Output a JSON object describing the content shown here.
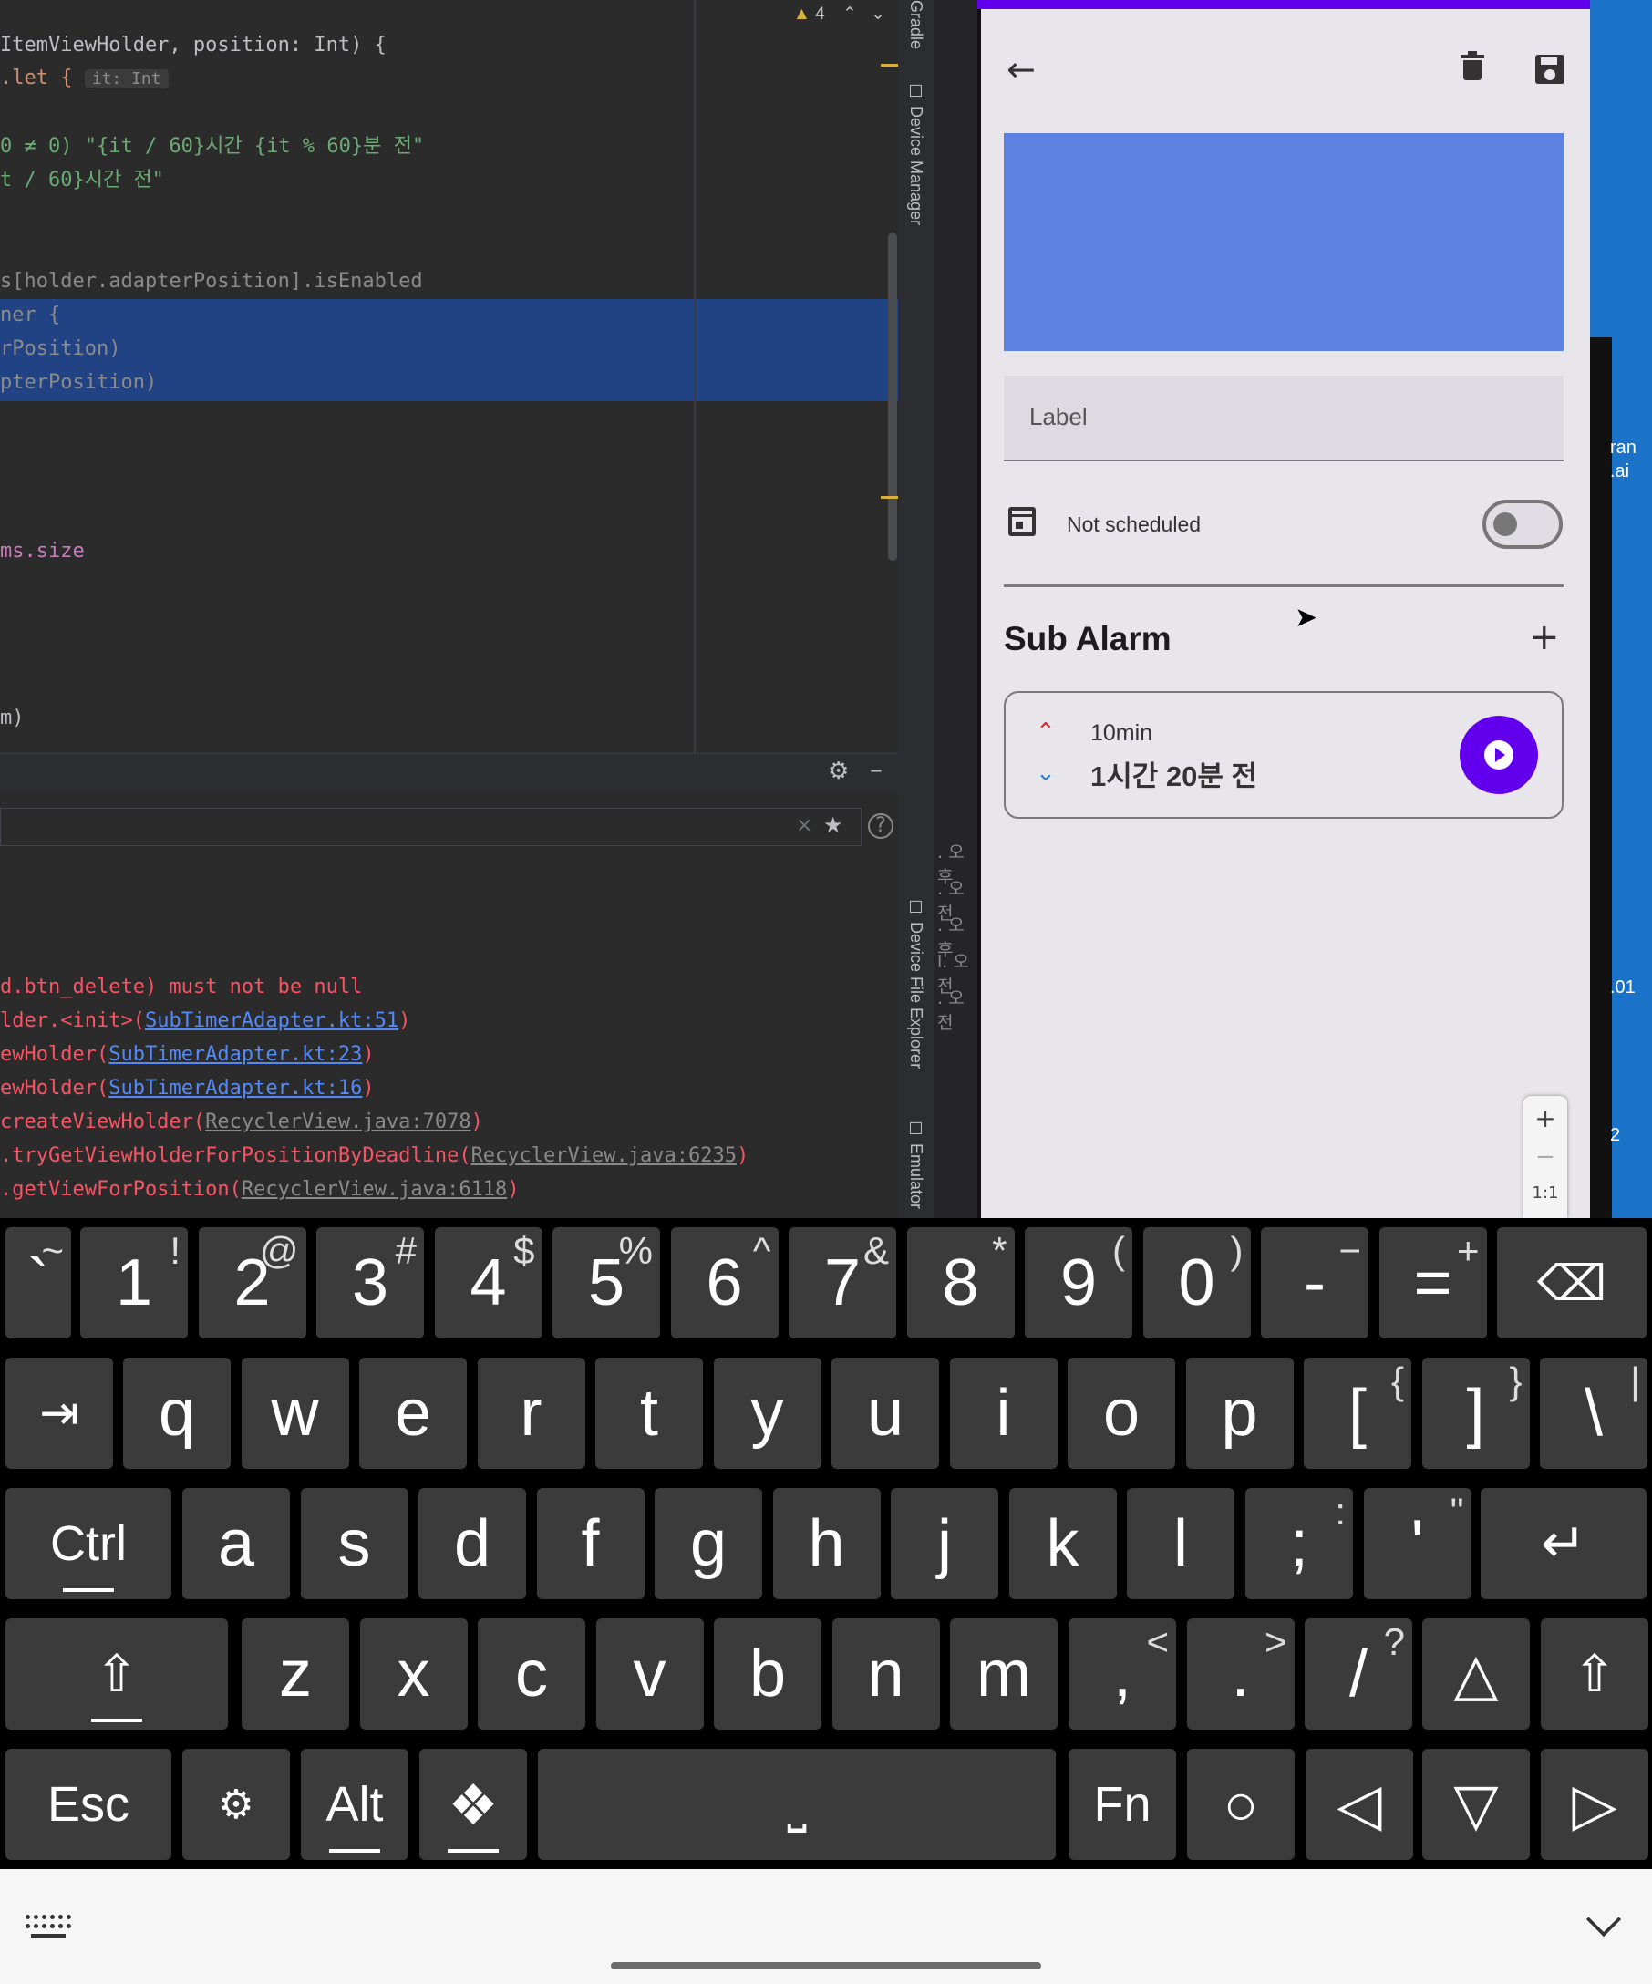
{
  "ide": {
    "warning_count": "4",
    "code_lines": [
      {
        "t": "ItemViewHolder, position: Int) {"
      },
      {
        "t": ".let {"
      },
      {
        "t": "0 ≠ 0) \"{it / 60}시간 {it % 60}분 전\""
      },
      {
        "t": "t / 60}시간 전\""
      },
      {
        "t": "s[holder.adapterPosition].isEnabled"
      },
      {
        "t": "ner {"
      },
      {
        "t": "rPosition)"
      },
      {
        "t": "pterPosition)"
      },
      {
        "t": "ms.size"
      },
      {
        "t": "m)"
      }
    ],
    "inlay_hint": "it: Int",
    "side_tabs": [
      "Gradle",
      "Device Manager",
      "Device File Explorer",
      "Emulator"
    ],
    "console_lines": [
      {
        "plain": "d.btn_delete) must not be null",
        "link": "",
        "tail": "",
        "style": "err"
      },
      {
        "plain": "lder.<init>(",
        "link": "SubTimerAdapter.kt:51",
        "tail": ")",
        "style": "err"
      },
      {
        "plain": "ewHolder(",
        "link": "SubTimerAdapter.kt:23",
        "tail": ")",
        "style": "err"
      },
      {
        "plain": "ewHolder(",
        "link": "SubTimerAdapter.kt:16",
        "tail": ")",
        "style": "err"
      },
      {
        "plain": "createViewHolder(",
        "link": "RecyclerView.java:7078",
        "tail": ")",
        "style": "errg"
      },
      {
        "plain": ".tryGetViewHolderForPositionByDeadline(",
        "link": "RecyclerView.java:6235",
        "tail": ")",
        "style": "errg"
      },
      {
        "plain": ".getViewForPosition(",
        "link": "RecyclerView.java:6118",
        "tail": ")",
        "style": "errg"
      }
    ],
    "log_fragments": [
      ". 오후",
      ". 오전",
      ". 오후",
      "l. 오전",
      ". 오전"
    ]
  },
  "phone": {
    "label_placeholder": "Label",
    "schedule_text": "Not scheduled",
    "sub_alarm_title": "Sub Alarm",
    "sub_item": {
      "duration": "10min",
      "time_before": "1시간 20분 전"
    },
    "zoom": {
      "plus": "+",
      "minus": "−",
      "ratio": "1:1"
    },
    "accent": "#6200ee",
    "color_block": "#5b82e3"
  },
  "right_edge_text": [
    "ran",
    ".ai",
    ".01",
    "2"
  ],
  "keyboard": {
    "row1": [
      {
        "m": "`",
        "s": "~"
      },
      {
        "m": "1",
        "s": "!"
      },
      {
        "m": "2",
        "s": "@"
      },
      {
        "m": "3",
        "s": "#"
      },
      {
        "m": "4",
        "s": "$"
      },
      {
        "m": "5",
        "s": "%"
      },
      {
        "m": "6",
        "s": "^"
      },
      {
        "m": "7",
        "s": "&"
      },
      {
        "m": "8",
        "s": "*"
      },
      {
        "m": "9",
        "s": "("
      },
      {
        "m": "0",
        "s": ")"
      },
      {
        "m": "-",
        "s": "−"
      },
      {
        "m": "=",
        "s": "+"
      }
    ],
    "row2": [
      "q",
      "w",
      "e",
      "r",
      "t",
      "y",
      "u",
      "i",
      "o",
      "p"
    ],
    "row2_sym": [
      {
        "m": "[",
        "s": "{"
      },
      {
        "m": "]",
        "s": "}"
      },
      {
        "m": "\\",
        "s": "|"
      }
    ],
    "row3": [
      "a",
      "s",
      "d",
      "f",
      "g",
      "h",
      "j",
      "k",
      "l"
    ],
    "row3_sym": [
      {
        "m": ";",
        "s": ":"
      },
      {
        "m": "'",
        "s": "\""
      }
    ],
    "row4": [
      "z",
      "x",
      "c",
      "v",
      "b",
      "n",
      "m"
    ],
    "row4_sym": [
      {
        "m": ",",
        "s": "<"
      },
      {
        "m": ".",
        "s": ">"
      },
      {
        "m": "/",
        "s": "?"
      }
    ],
    "ctrl": "Ctrl",
    "esc": "Esc",
    "alt": "Alt",
    "fn": "Fn",
    "space": "⎵"
  }
}
